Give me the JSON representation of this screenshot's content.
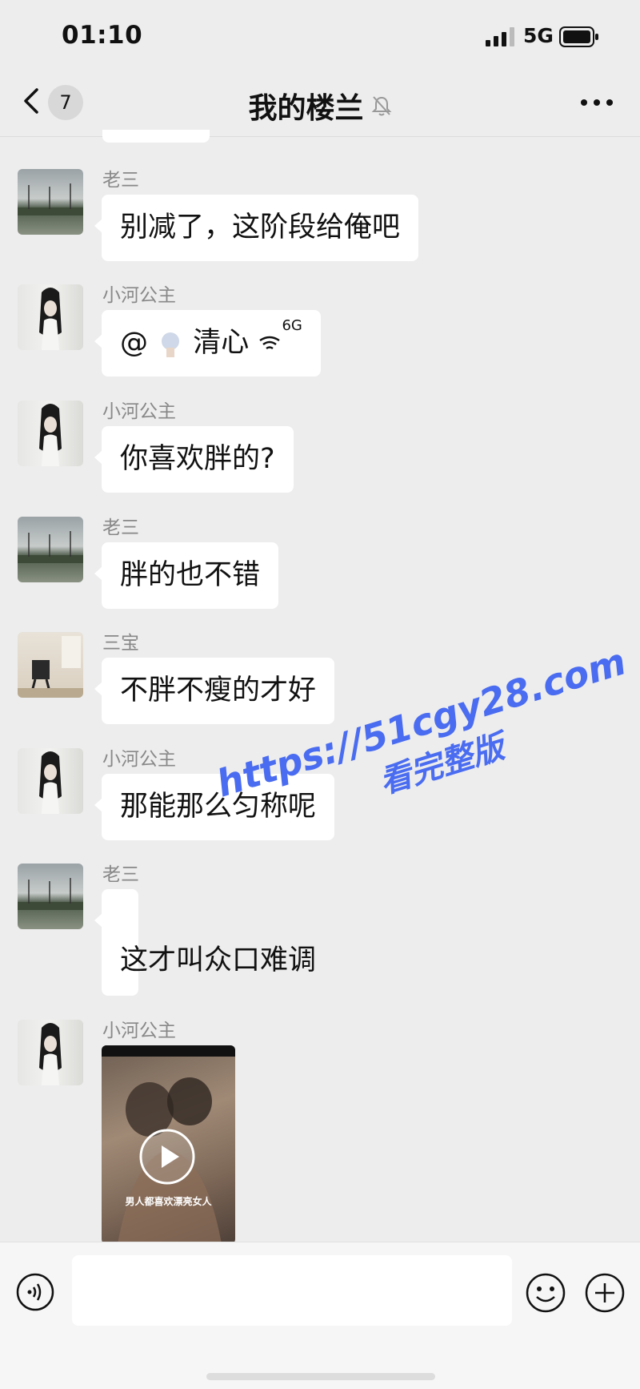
{
  "status_bar": {
    "time": "01:10",
    "network": "5G",
    "icons": [
      "signal-icon",
      "battery-icon"
    ]
  },
  "header": {
    "back_icon": "chevron-left-icon",
    "unread_count": "7",
    "title": "我的楼兰",
    "mute_icon": "bell-off-icon",
    "more_icon": "more-dots-icon"
  },
  "messages": [
    {
      "sender": "老三",
      "text": "别减了，这阶段给俺吧"
    },
    {
      "sender": "小河公主",
      "mention": "@",
      "mention_name": "清心",
      "mention_suffix": "6G"
    },
    {
      "sender": "小河公主",
      "text": "你喜欢胖的?"
    },
    {
      "sender": "老三",
      "text": "胖的也不错"
    },
    {
      "sender": "三宝",
      "text": "不胖不瘦的才好"
    },
    {
      "sender": "小河公主",
      "text": "那能那么匀称呢"
    },
    {
      "sender": "老三",
      "text": "这才叫众口难调"
    },
    {
      "sender": "小河公主",
      "video_caption": "男人都喜欢漂亮女人"
    }
  ],
  "watermark": {
    "line1": "https://51cgy28.com",
    "line2": "看完整版"
  },
  "input_bar": {
    "voice_icon": "voice-icon",
    "emoji_icon": "emoji-icon",
    "plus_icon": "plus-icon",
    "input_value": ""
  },
  "colors": {
    "background": "#ededed",
    "bubble": "#ffffff",
    "watermark": "#4a6cf0"
  }
}
